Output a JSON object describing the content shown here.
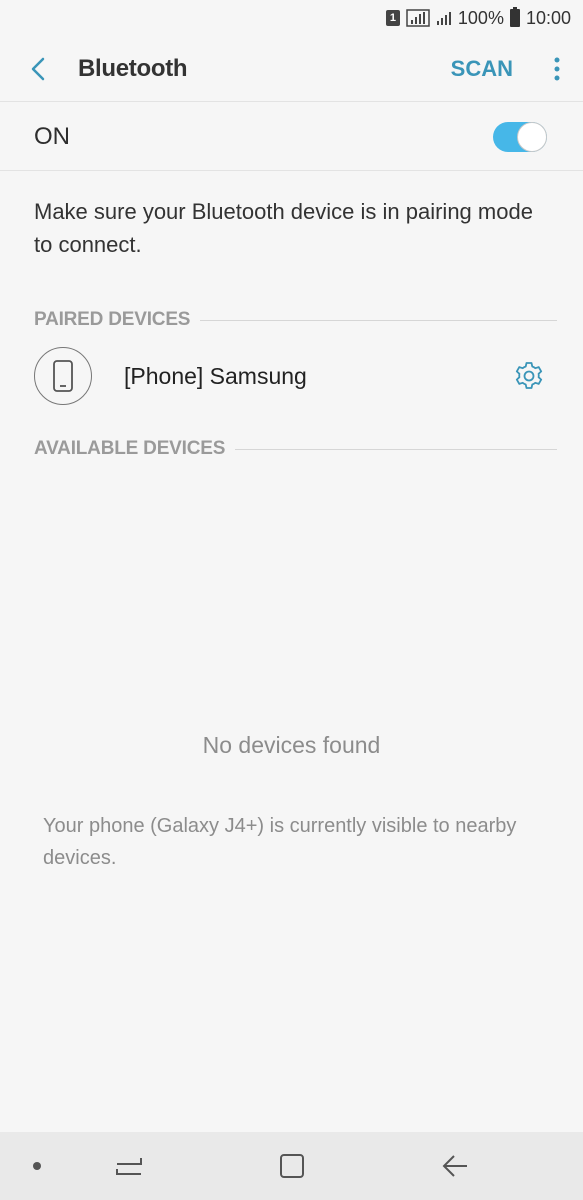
{
  "status_bar": {
    "sim_label": "1",
    "battery_text": "100%",
    "time": "10:00",
    "icons": [
      "sim-icon",
      "signal-icon",
      "signal-icon",
      "battery-icon"
    ]
  },
  "app_bar": {
    "title": "Bluetooth",
    "scan_label": "SCAN",
    "accent_color": "#3a95b8"
  },
  "toggle": {
    "label": "ON",
    "state": true,
    "on_color": "#46b7e8"
  },
  "description": "Make sure your Bluetooth device is in pairing mode to connect.",
  "paired_section": {
    "header": "PAIRED DEVICES",
    "devices": [
      {
        "name": "[Phone] Samsung",
        "icon": "phone-icon"
      }
    ]
  },
  "available_section": {
    "header": "AVAILABLE DEVICES",
    "empty_text": "No devices found"
  },
  "visibility_text": "Your phone (Galaxy J4+) is currently visible to nearby devices.",
  "nav_bar": {
    "buttons": [
      "recents-icon",
      "home-icon",
      "back-icon"
    ]
  }
}
